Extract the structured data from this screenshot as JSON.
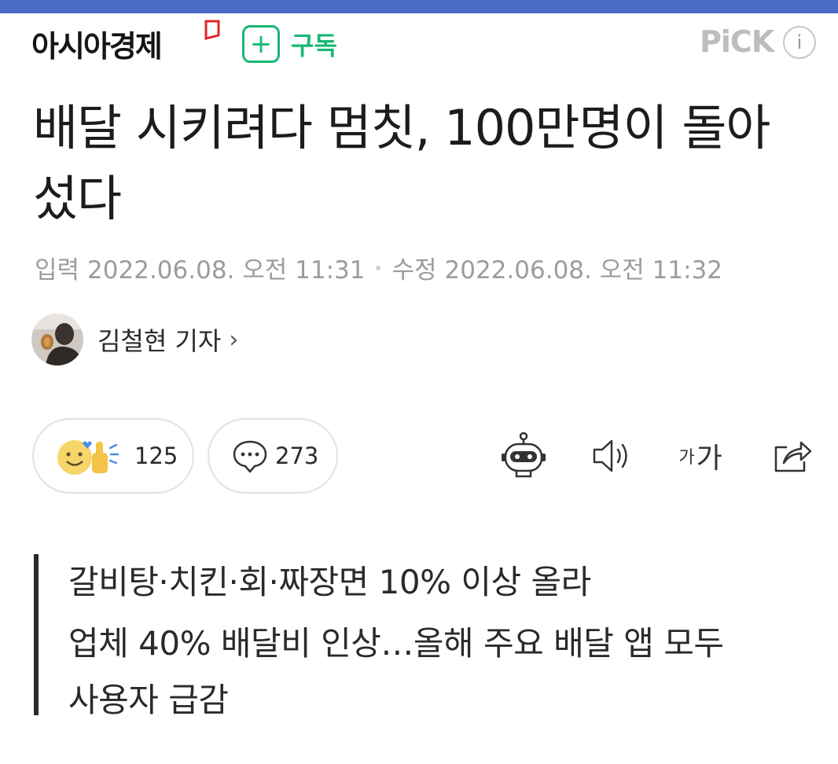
{
  "header": {
    "logo_text": "아시아경제",
    "subscribe_plus": "+",
    "subscribe_label": "구독",
    "pick_label": "PiCK",
    "info_label": "i"
  },
  "article": {
    "headline": "배달 시키려다 멈칫, 100만명이 돌아섰다",
    "input_label": "입력",
    "input_datetime": "2022.06.08. 오전 11:31",
    "modified_label": "수정",
    "modified_datetime": "2022.06.08. 오전 11:32",
    "author_name": "김철현 기자",
    "author_chevron": "›"
  },
  "actions": {
    "reaction_count": "125",
    "comment_count": "273",
    "fontsize_small": "가",
    "fontsize_large": "가"
  },
  "summary": {
    "lines": [
      "갈비탕·치킨·회·짜장면 10% 이상 올라",
      "업체 40% 배달비 인상…올해 주요 배달 앱 모두",
      "사용자 급감"
    ]
  },
  "colors": {
    "topbar": "#4a6bc4",
    "subscribe_green": "#18b874",
    "logo_mark_red": "#e0262f",
    "pick_gray": "#bdbdbd"
  },
  "icons": [
    "logo-mark-icon",
    "plus-icon",
    "info-icon",
    "reaction-emoji-icon",
    "comment-bubble-icon",
    "robot-summary-icon",
    "speaker-icon",
    "share-icon",
    "chevron-right-icon"
  ]
}
